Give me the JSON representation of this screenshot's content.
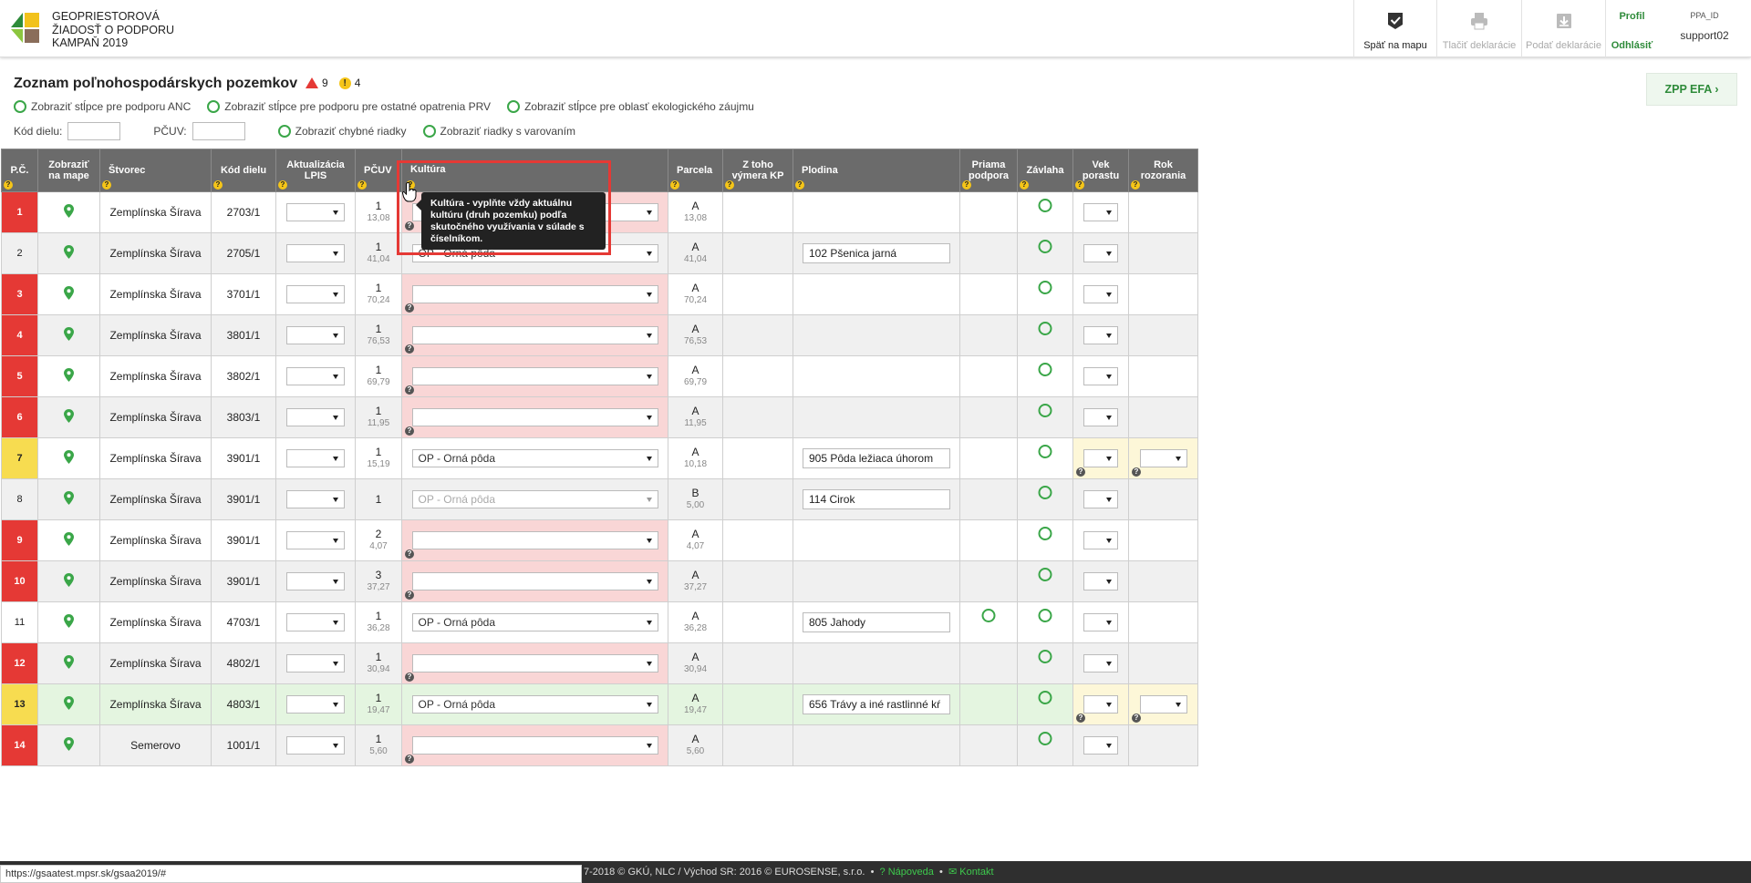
{
  "app": {
    "title_lines": [
      "GEOPRIESTOROVÁ",
      "ŽIADOSŤ O PODPORU",
      "KAMPAŇ 2019"
    ]
  },
  "header": {
    "back_to_map": "Späť na mapu",
    "print_decl": "Tlačiť deklarácie",
    "submit_decl": "Podať deklarácie",
    "profile": "Profil",
    "logout": "Odhlásiť",
    "ppa_label": "PPA_ID",
    "username": "support02"
  },
  "page": {
    "title": "Zoznam poľnohospodárskych pozemkov",
    "error_count": "9",
    "warning_count": "4",
    "toggles": [
      "Zobraziť stĺpce pre podporu ANC",
      "Zobraziť stĺpce pre podporu pre ostatné opatrenia PRV",
      "Zobraziť stĺpce pre oblasť ekologického záujmu"
    ],
    "filter_kod_label": "Kód dielu:",
    "filter_pcuv_label": "PČUV:",
    "show_errors": "Zobraziť chybné riadky",
    "show_warnings": "Zobraziť riadky s varovaním",
    "zpp_button": "ZPP EFA"
  },
  "columns": {
    "pc": "P.Č.",
    "map1": "Zobraziť",
    "map2": "na mape",
    "stvorec": "Štvorec",
    "kod": "Kód dielu",
    "lpis1": "Aktualizácia",
    "lpis2": "LPIS",
    "pcuv": "PČUV",
    "kultura": "Kultúra",
    "parcela": "Parcela",
    "kp1": "Z toho",
    "kp2": "výmera KP",
    "plodina": "Plodina",
    "pp1": "Priama",
    "pp2": "podpora",
    "zavlaha": "Závlaha",
    "vek1": "Vek",
    "vek2": "porastu",
    "rok1": "Rok",
    "rok2": "rozorania"
  },
  "rows": [
    {
      "no": "1",
      "status": "error",
      "stvorec": "Zemplínska Šírava",
      "kod": "2703/1",
      "pcuv": "1",
      "pcuv_area": "13,08",
      "kultura": "",
      "kultura_err": true,
      "parcela": "A",
      "parcela_area": "13,08",
      "plodina": "",
      "priama": false,
      "vek_warn": false,
      "rok": false
    },
    {
      "no": "2",
      "status": "ok",
      "stvorec": "Zemplínska Šírava",
      "kod": "2705/1",
      "pcuv": "1",
      "pcuv_area": "41,04",
      "kultura": "OP - Orná pôda",
      "kultura_err": false,
      "parcela": "A",
      "parcela_area": "41,04",
      "plodina": "102  Pšenica jarná",
      "priama": false,
      "vek_warn": false,
      "rok": false
    },
    {
      "no": "3",
      "status": "error",
      "stvorec": "Zemplínska Šírava",
      "kod": "3701/1",
      "pcuv": "1",
      "pcuv_area": "70,24",
      "kultura": "",
      "kultura_err": true,
      "parcela": "A",
      "parcela_area": "70,24",
      "plodina": "",
      "priama": false,
      "vek_warn": false,
      "rok": false
    },
    {
      "no": "4",
      "status": "error",
      "stvorec": "Zemplínska Šírava",
      "kod": "3801/1",
      "pcuv": "1",
      "pcuv_area": "76,53",
      "kultura": "",
      "kultura_err": true,
      "parcela": "A",
      "parcela_area": "76,53",
      "plodina": "",
      "priama": false,
      "vek_warn": false,
      "rok": false
    },
    {
      "no": "5",
      "status": "error",
      "stvorec": "Zemplínska Šírava",
      "kod": "3802/1",
      "pcuv": "1",
      "pcuv_area": "69,79",
      "kultura": "",
      "kultura_err": true,
      "parcela": "A",
      "parcela_area": "69,79",
      "plodina": "",
      "priama": false,
      "vek_warn": false,
      "rok": false
    },
    {
      "no": "6",
      "status": "error",
      "stvorec": "Zemplínska Šírava",
      "kod": "3803/1",
      "pcuv": "1",
      "pcuv_area": "11,95",
      "kultura": "",
      "kultura_err": true,
      "parcela": "A",
      "parcela_area": "11,95",
      "plodina": "",
      "priama": false,
      "vek_warn": false,
      "rok": false
    },
    {
      "no": "7",
      "status": "warn",
      "stvorec": "Zemplínska Šírava",
      "kod": "3901/1",
      "pcuv": "1",
      "pcuv_area": "15,19",
      "kultura": "OP - Orná pôda",
      "kultura_err": false,
      "parcela": "A",
      "parcela_area": "10,18",
      "plodina": "905  Pôda ležiaca úhorom",
      "priama": false,
      "vek_warn": true,
      "rok": true
    },
    {
      "no": "8",
      "status": "ok",
      "stvorec": "Zemplínska Šírava",
      "kod": "3901/1",
      "pcuv": "1",
      "pcuv_area": "",
      "kultura": "OP - Orná pôda",
      "kultura_err": false,
      "kultura_ro": true,
      "parcela": "B",
      "parcela_area": "5,00",
      "plodina": "114  Cirok",
      "priama": false,
      "vek_warn": false,
      "rok": false
    },
    {
      "no": "9",
      "status": "error",
      "stvorec": "Zemplínska Šírava",
      "kod": "3901/1",
      "pcuv": "2",
      "pcuv_area": "4,07",
      "kultura": "",
      "kultura_err": true,
      "parcela": "A",
      "parcela_area": "4,07",
      "plodina": "",
      "priama": false,
      "vek_warn": false,
      "rok": false
    },
    {
      "no": "10",
      "status": "error",
      "stvorec": "Zemplínska Šírava",
      "kod": "3901/1",
      "pcuv": "3",
      "pcuv_area": "37,27",
      "kultura": "",
      "kultura_err": true,
      "parcela": "A",
      "parcela_area": "37,27",
      "plodina": "",
      "priama": false,
      "vek_warn": false,
      "rok": false
    },
    {
      "no": "11",
      "status": "ok",
      "stvorec": "Zemplínska Šírava",
      "kod": "4703/1",
      "pcuv": "1",
      "pcuv_area": "36,28",
      "kultura": "OP - Orná pôda",
      "kultura_err": false,
      "parcela": "A",
      "parcela_area": "36,28",
      "plodina": "805  Jahody",
      "priama": true,
      "vek_warn": false,
      "rok": false
    },
    {
      "no": "12",
      "status": "error",
      "stvorec": "Zemplínska Šírava",
      "kod": "4802/1",
      "pcuv": "1",
      "pcuv_area": "30,94",
      "kultura": "",
      "kultura_err": true,
      "parcela": "A",
      "parcela_area": "30,94",
      "plodina": "",
      "priama": false,
      "vek_warn": false,
      "rok": false
    },
    {
      "no": "13",
      "status": "warn",
      "stvorec": "Zemplínska Šírava",
      "kod": "4803/1",
      "pcuv": "1",
      "pcuv_area": "19,47",
      "kultura": "OP - Orná pôda",
      "kultura_err": false,
      "parcela": "A",
      "parcela_area": "19,47",
      "plodina": "656  Trávy a iné rastlinné kŕ",
      "priama": false,
      "vek_warn": true,
      "rok": true,
      "green": true
    },
    {
      "no": "14",
      "status": "error",
      "stvorec": "Semerovo",
      "kod": "1001/1",
      "pcuv": "1",
      "pcuv_area": "5,60",
      "kultura": "",
      "kultura_err": true,
      "parcela": "A",
      "parcela_area": "5,60",
      "plodina": "",
      "priama": false,
      "vek_warn": false,
      "rok": false
    }
  ],
  "tooltip": {
    "lines": [
      "Kultúra - vyplňte vždy aktuálnu",
      "kultúru (druh pozemku) podľa",
      "skutočného využívania v súlade s",
      "číselníkom."
    ]
  },
  "footer": {
    "copyright": "7-2018 © GKÚ, NLC / Východ SR: 2016 © EUROSENSE, s.r.o.",
    "help": "Nápoveda",
    "contact": "Kontakt"
  },
  "statusbar": {
    "url": "https://gsaatest.mpsr.sk/gsaa2019/#"
  },
  "colors": {
    "accent": "#3aa648",
    "error": "#e53935",
    "warning": "#f7dc50",
    "header_bg": "#6b6b6b"
  }
}
